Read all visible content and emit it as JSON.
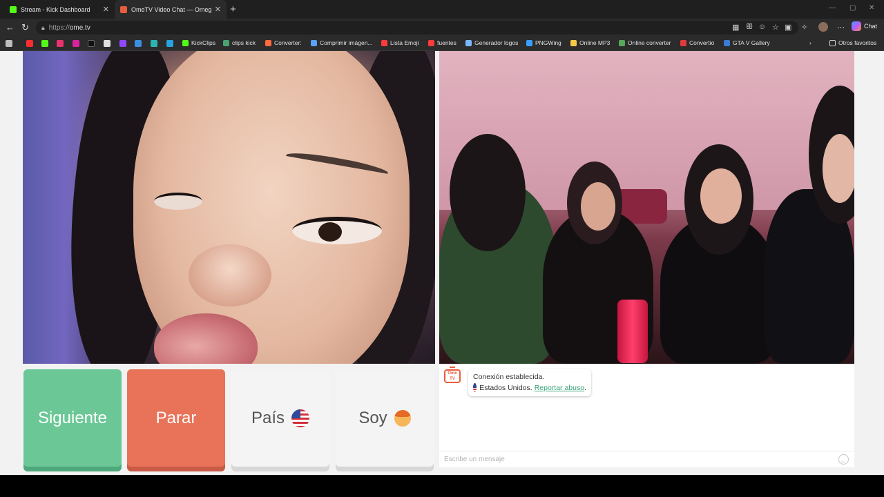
{
  "tabs": [
    {
      "title": "Stream - Kick Dashboard",
      "favicon_color": "#53fc18",
      "active": false
    },
    {
      "title": "OmeTV Video Chat — Omegl",
      "favicon_color": "#e85d3d",
      "active": true
    }
  ],
  "address_bar": {
    "scheme": "https://",
    "host": "ome.tv"
  },
  "toolbar": {
    "chat_label": "Chat"
  },
  "bookmarks": [
    {
      "label": "KickClips",
      "color": "#53fc18"
    },
    {
      "label": "clips kick",
      "color": "#4aa36f"
    },
    {
      "label": "Converter:",
      "color": "#ff6b3d"
    },
    {
      "label": "Comprimir imágen...",
      "color": "#5aa0ff"
    },
    {
      "label": "Lista Emoji",
      "color": "#ff3b3b"
    },
    {
      "label": "fuentes",
      "color": "#ff3b3b"
    },
    {
      "label": "Generador logos",
      "color": "#7ab8ff"
    },
    {
      "label": "PNGWing",
      "color": "#3aa0ff"
    },
    {
      "label": "Online MP3",
      "color": "#f7c948"
    },
    {
      "label": "Online converter",
      "color": "#57a85a"
    },
    {
      "label": "Convertio",
      "color": "#e03b3b"
    },
    {
      "label": "GTA V Gallery",
      "color": "#3a7bd5"
    }
  ],
  "other_favorites": "Otros favoritos",
  "buttons": {
    "next": "Siguiente",
    "stop": "Parar",
    "country": "País",
    "soy": "Soy"
  },
  "chat": {
    "logo": "Ome TV",
    "connection": "Conexión establecida.",
    "country": "Estados Unidos.",
    "report": "Reportar abuso",
    "report_suffix": ".",
    "placeholder": "Escribe un mensaje"
  }
}
